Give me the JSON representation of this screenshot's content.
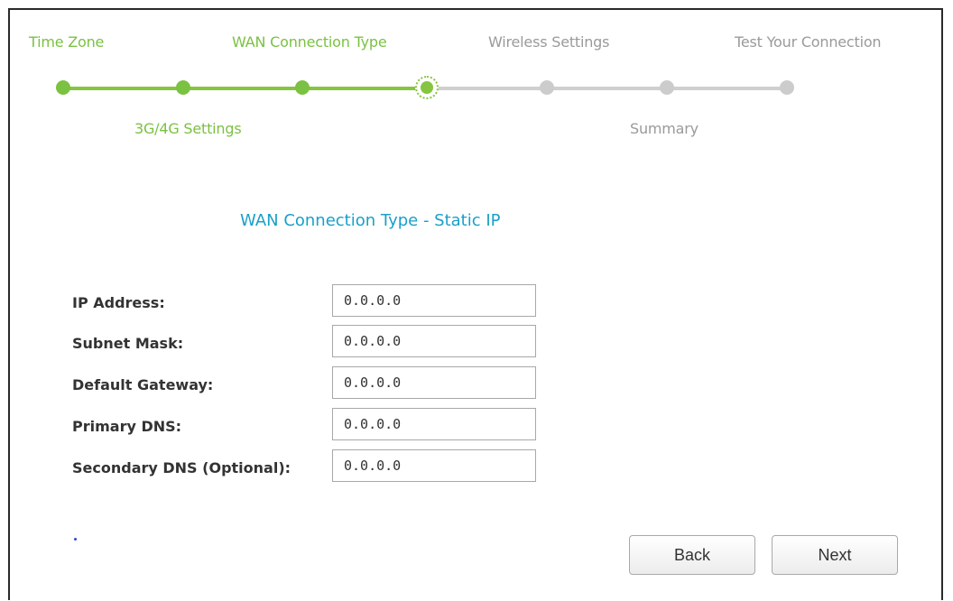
{
  "wizard": {
    "steps_top": [
      {
        "label": "Time Zone",
        "state": "done"
      },
      {
        "label": "WAN Connection Type",
        "state": "done"
      },
      {
        "label": "Wireless Settings",
        "state": "todo"
      },
      {
        "label": "Test Your Connection",
        "state": "todo"
      }
    ],
    "steps_bottom": [
      {
        "label": "3G/4G Settings",
        "state": "done"
      },
      {
        "label": "Summary",
        "state": "todo"
      }
    ],
    "colors": {
      "done": "#7bc142",
      "todo": "#9a9a9a",
      "title": "#1aa0c8"
    }
  },
  "form": {
    "title": "WAN Connection Type - Static IP",
    "fields": [
      {
        "label": "IP Address:",
        "value": "0.0.0.0"
      },
      {
        "label": "Subnet Mask:",
        "value": "0.0.0.0"
      },
      {
        "label": "Default Gateway:",
        "value": "0.0.0.0"
      },
      {
        "label": "Primary DNS:",
        "value": "0.0.0.0"
      },
      {
        "label": "Secondary DNS (Optional):",
        "value": "0.0.0.0"
      }
    ]
  },
  "buttons": {
    "back": "Back",
    "next": "Next"
  }
}
